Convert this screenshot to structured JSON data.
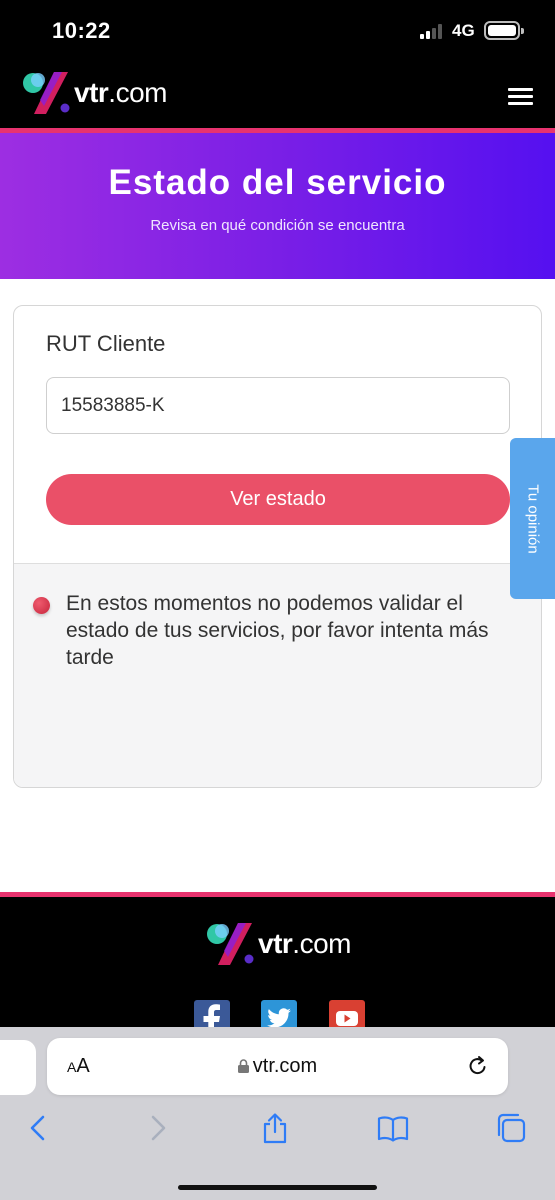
{
  "status_bar": {
    "time": "10:22",
    "network": "4G"
  },
  "header": {
    "logo_bold": "vtr",
    "logo_rest": ".com",
    "menu_icon": "hamburger-icon"
  },
  "banner": {
    "title": "Estado del servicio",
    "subtitle": "Revisa en qué condición se encuentra"
  },
  "form": {
    "rut_label": "RUT Cliente",
    "rut_value": "15583885-K",
    "submit_label": "Ver estado"
  },
  "result": {
    "message": "En estos momentos no podemos validar el estado de tus servicios, por favor intenta más tarde",
    "status_color": "#d9364d"
  },
  "feedback_tab": {
    "label": "Tu opinión"
  },
  "footer": {
    "logo_bold": "vtr",
    "logo_rest": ".com",
    "social": [
      "facebook-icon",
      "twitter-icon",
      "youtube-icon"
    ]
  },
  "browser": {
    "text_size_label_small": "A",
    "text_size_label_large": "A",
    "url": "vtr.com",
    "toolbar": [
      "back-icon",
      "forward-icon",
      "share-icon",
      "bookmarks-icon",
      "tabs-icon"
    ]
  },
  "colors": {
    "brand_pink": "#e8336f",
    "button_red": "#ea5068",
    "banner_start": "#9d2ee2",
    "banner_end": "#5510f0",
    "feedback_blue": "#5aa6ec",
    "safari_blue": "#2f7cf6"
  }
}
